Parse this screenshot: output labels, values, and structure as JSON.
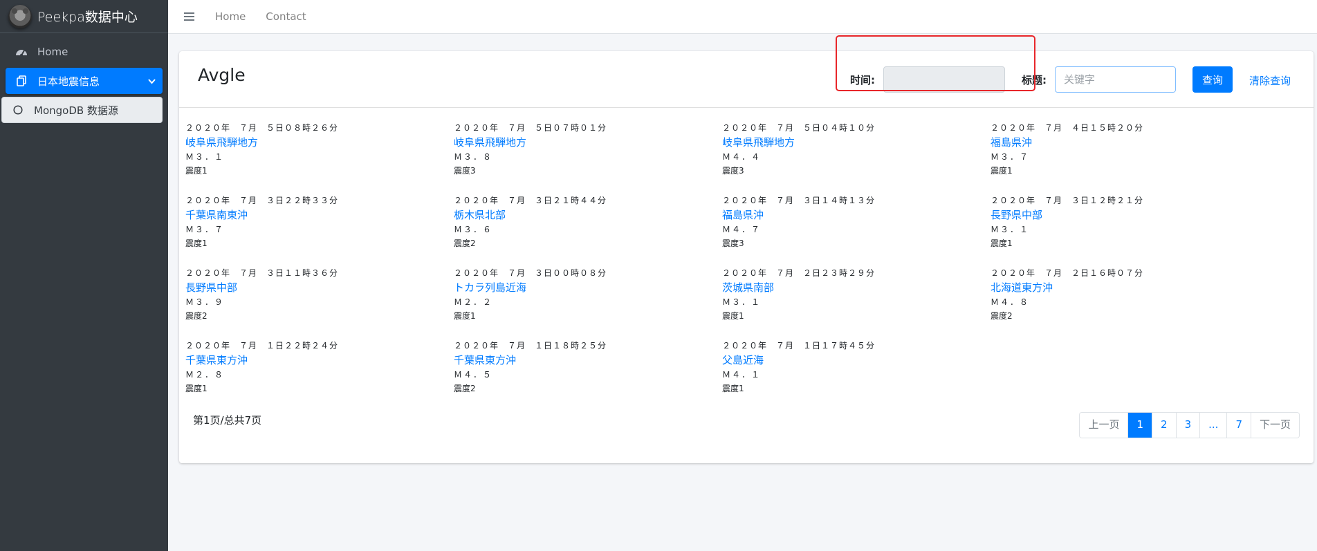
{
  "brand": {
    "title": "Peekpa数据中心"
  },
  "sidebar": {
    "items": [
      {
        "label": "Home"
      },
      {
        "label": "日本地震信息"
      },
      {
        "label": "MongoDB 数据源"
      }
    ]
  },
  "topnav": {
    "home": "Home",
    "contact": "Contact"
  },
  "card": {
    "title": "Avgle",
    "time_label": "时间:",
    "title_label": "标题:",
    "keyword_placeholder": "关键字",
    "query_button": "查询",
    "clear_button": "清除查询"
  },
  "entries": [
    {
      "time": "２０２０年　７月　５日０８時２６分",
      "place": "岐阜県飛騨地方",
      "magnitude": "Ｍ３．１",
      "intensity": "震度1"
    },
    {
      "time": "２０２０年　７月　５日０７時０１分",
      "place": "岐阜県飛騨地方",
      "magnitude": "Ｍ３．８",
      "intensity": "震度3"
    },
    {
      "time": "２０２０年　７月　５日０４時１０分",
      "place": "岐阜県飛騨地方",
      "magnitude": "Ｍ４．４",
      "intensity": "震度3"
    },
    {
      "time": "２０２０年　７月　４日１５時２０分",
      "place": "福島県沖",
      "magnitude": "Ｍ３．７",
      "intensity": "震度1"
    },
    {
      "time": "２０２０年　７月　３日２２時３３分",
      "place": "千葉県南東沖",
      "magnitude": "Ｍ３．７",
      "intensity": "震度1"
    },
    {
      "time": "２０２０年　７月　３日２１時４４分",
      "place": "栃木県北部",
      "magnitude": "Ｍ３．６",
      "intensity": "震度2"
    },
    {
      "time": "２０２０年　７月　３日１４時１３分",
      "place": "福島県沖",
      "magnitude": "Ｍ４．７",
      "intensity": "震度3"
    },
    {
      "time": "２０２０年　７月　３日１２時２１分",
      "place": "長野県中部",
      "magnitude": "Ｍ３．１",
      "intensity": "震度1"
    },
    {
      "time": "２０２０年　７月　３日１１時３６分",
      "place": "長野県中部",
      "magnitude": "Ｍ３．９",
      "intensity": "震度2"
    },
    {
      "time": "２０２０年　７月　３日００時０８分",
      "place": "トカラ列島近海",
      "magnitude": "Ｍ２．２",
      "intensity": "震度1"
    },
    {
      "time": "２０２０年　７月　２日２３時２９分",
      "place": "茨城県南部",
      "magnitude": "Ｍ３．１",
      "intensity": "震度1"
    },
    {
      "time": "２０２０年　７月　２日１６時０７分",
      "place": "北海道東方沖",
      "magnitude": "Ｍ４．８",
      "intensity": "震度2"
    },
    {
      "time": "２０２０年　７月　１日２２時２４分",
      "place": "千葉県東方沖",
      "magnitude": "Ｍ２．８",
      "intensity": "震度1"
    },
    {
      "time": "２０２０年　７月　１日１８時２５分",
      "place": "千葉県東方沖",
      "magnitude": "Ｍ４．５",
      "intensity": "震度2"
    },
    {
      "time": "２０２０年　７月　１日１７時４５分",
      "place": "父島近海",
      "magnitude": "Ｍ４．１",
      "intensity": "震度1"
    }
  ],
  "pagination": {
    "info": "第1页/总共7页",
    "prev": "上一页",
    "pages": [
      "1",
      "2",
      "3",
      "...",
      "7"
    ],
    "next": "下一页"
  },
  "colors": {
    "accent": "#007bff",
    "sidebar": "#343a40",
    "highlight": "#e8262a"
  }
}
